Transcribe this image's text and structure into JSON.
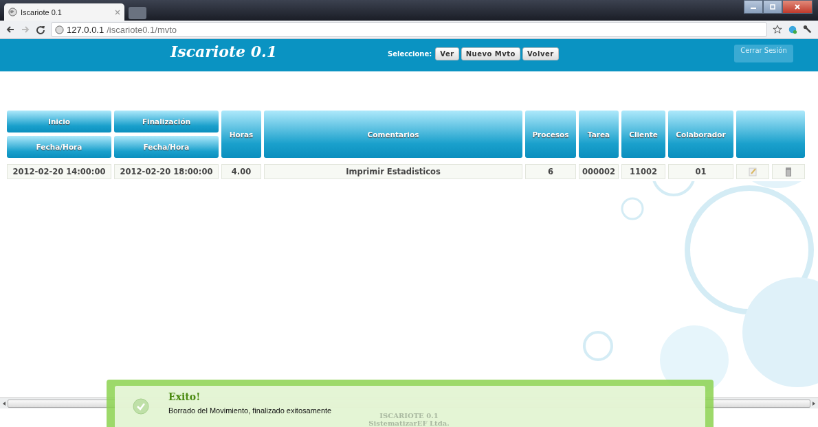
{
  "browser": {
    "tab_title": "Iscariote 0.1",
    "url_host": "127.0.0.1",
    "url_path": "/iscariote0.1/mvto"
  },
  "header": {
    "logo": "Iscariote 0.1",
    "select_label": "Seleccione:",
    "buttons": [
      "Ver",
      "Nuevo Mvto",
      "Volver"
    ],
    "logout": "Cerrar Sesión"
  },
  "table": {
    "columns": [
      {
        "label": "Inicio",
        "sub": "Fecha/Hora"
      },
      {
        "label": "Finalización",
        "sub": "Fecha/Hora"
      },
      {
        "label": "Horas"
      },
      {
        "label": "Comentarios"
      },
      {
        "label": "Procesos"
      },
      {
        "label": "Tarea"
      },
      {
        "label": "Cliente"
      },
      {
        "label": "Colaborador"
      }
    ],
    "rows": [
      {
        "cells": [
          "2012-02-20 14:00:00",
          "2012-02-20 18:00:00",
          "4.00",
          "Imprimir Estadisticos",
          "6",
          "000002",
          "11002",
          "01"
        ]
      }
    ]
  },
  "footer": {
    "lines": [
      "ISCARIOTE 0.1",
      "SistematizarEF Ltda."
    ]
  },
  "notification": {
    "title": "Exito!",
    "message": "Borrado del Movimiento, finalizado exitosamente"
  }
}
